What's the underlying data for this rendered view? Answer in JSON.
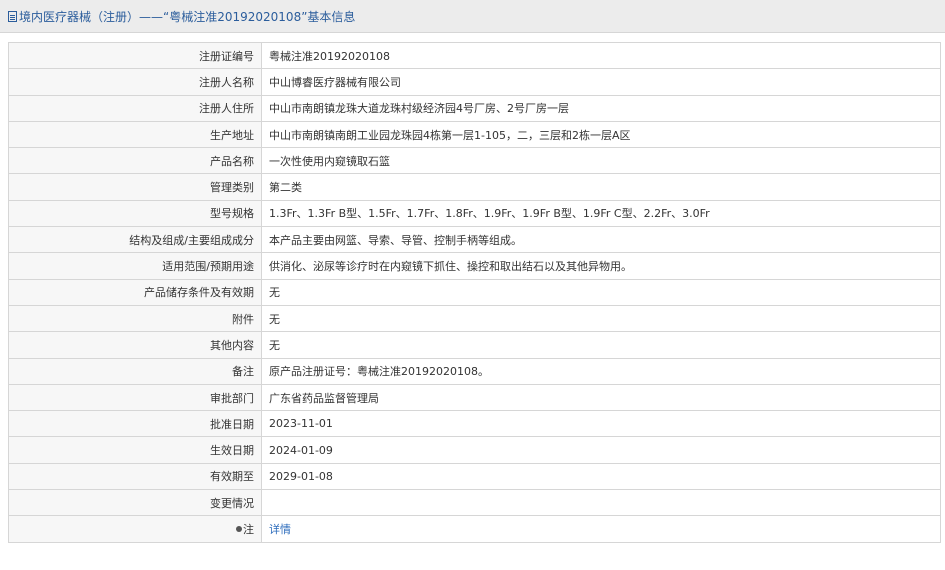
{
  "header": {
    "title": "境内医疗器械（注册）——“粤械注准20192020108”基本信息"
  },
  "rows": [
    {
      "label": "注册证编号",
      "value": "粤械注准20192020108"
    },
    {
      "label": "注册人名称",
      "value": "中山博睿医疗器械有限公司"
    },
    {
      "label": "注册人住所",
      "value": "中山市南朗镇龙珠大道龙珠村级经济园4号厂房、2号厂房一层"
    },
    {
      "label": "生产地址",
      "value": "中山市南朗镇南朗工业园龙珠园4栋第一层1-105，二，三层和2栋一层A区"
    },
    {
      "label": "产品名称",
      "value": "一次性使用内窥镜取石篮"
    },
    {
      "label": "管理类别",
      "value": "第二类"
    },
    {
      "label": "型号规格",
      "value": "1.3Fr、1.3Fr B型、1.5Fr、1.7Fr、1.8Fr、1.9Fr、1.9Fr B型、1.9Fr C型、2.2Fr、3.0Fr"
    },
    {
      "label": "结构及组成/主要组成成分",
      "value": "本产品主要由网篮、导索、导管、控制手柄等组成。"
    },
    {
      "label": "适用范围/预期用途",
      "value": "供消化、泌尿等诊疗时在内窥镜下抓住、操控和取出结石以及其他异物用。"
    },
    {
      "label": "产品储存条件及有效期",
      "value": "无"
    },
    {
      "label": "附件",
      "value": "无"
    },
    {
      "label": "其他内容",
      "value": "无"
    },
    {
      "label": "备注",
      "value": "原产品注册证号：粤械注准20192020108。"
    },
    {
      "label": "审批部门",
      "value": "广东省药品监督管理局"
    },
    {
      "label": "批准日期",
      "value": "2023-11-01"
    },
    {
      "label": "生效日期",
      "value": "2024-01-09"
    },
    {
      "label": "有效期至",
      "value": "2029-01-08"
    },
    {
      "label": "变更情况",
      "value": ""
    }
  ],
  "note_row": {
    "label": "注",
    "link": "详情"
  },
  "colors": {
    "header_bg": "#ececec",
    "title_color": "#2b5d9c",
    "link_color": "#2b6bbb",
    "border": "#d6d6d6"
  }
}
